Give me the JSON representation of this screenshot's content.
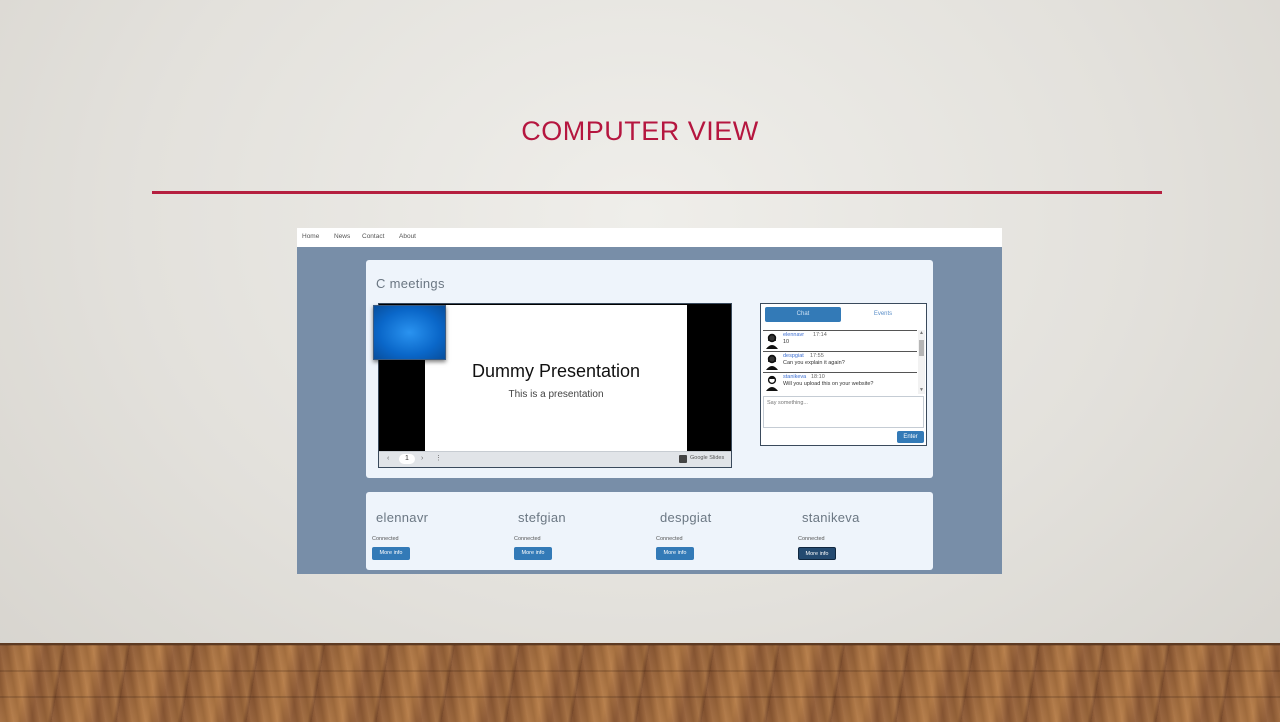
{
  "slide": {
    "title": "COMPUTER VIEW"
  },
  "nav": {
    "items": [
      "Home",
      "News",
      "Contact",
      "About"
    ]
  },
  "meeting": {
    "title": "C meetings"
  },
  "presentation": {
    "heading": "Dummy Presentation",
    "subtitle": "This is a presentation",
    "controls": {
      "prev": "‹",
      "page": "1",
      "next": "›",
      "more": "⋮",
      "brand": "Google Slides"
    }
  },
  "chat": {
    "tabs": [
      "Chat",
      "Events"
    ],
    "messages": [
      {
        "user": "elennavr",
        "time": "17:14",
        "text": "10"
      },
      {
        "user": "despgiat",
        "time": "17:55",
        "text": "Can you explain it again?"
      },
      {
        "user": "stanikeva",
        "time": "18:10",
        "text": "Will you upload this on your website?"
      }
    ],
    "input_placeholder": "Say something...",
    "enter_label": "Enter"
  },
  "participants": [
    {
      "name": "elennavr",
      "status": "Connected",
      "button": "More info"
    },
    {
      "name": "stefgian",
      "status": "Connected",
      "button": "More info"
    },
    {
      "name": "despgiat",
      "status": "Connected",
      "button": "More info"
    },
    {
      "name": "stanikeva",
      "status": "Connected",
      "button": "More info"
    }
  ],
  "colors": {
    "accent_red": "#b5163f",
    "primary_blue": "#337ab7",
    "app_background": "#788ea8",
    "panel": "#eef4fb"
  }
}
